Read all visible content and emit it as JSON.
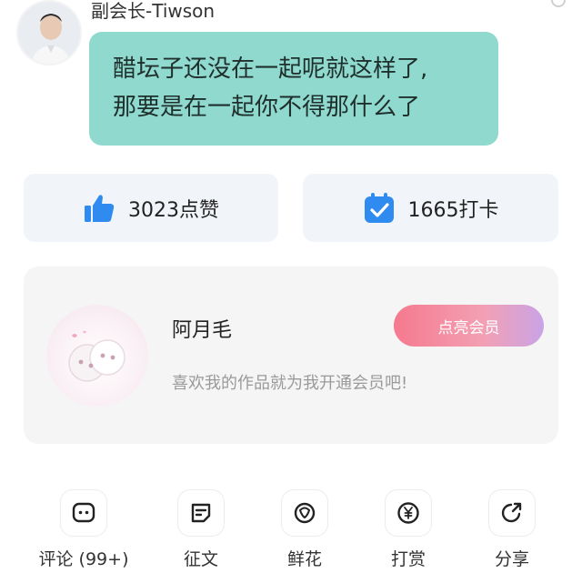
{
  "post": {
    "author": "副会长-Tiwson",
    "message_lines": [
      "醋坛子还没在一起呢就这样了,",
      "那要是在一起你不得那什么了"
    ]
  },
  "stats": {
    "likes": "3023点赞",
    "checkins": "1665打卡"
  },
  "member": {
    "name": "阿月毛",
    "tip": "喜欢我的作品就为我开通会员吧!",
    "button": "点亮会员"
  },
  "actions": [
    {
      "label": "评论 (99+)",
      "icon": "comment-icon"
    },
    {
      "label": "征文",
      "icon": "article-icon"
    },
    {
      "label": "鲜花",
      "icon": "flower-icon"
    },
    {
      "label": "打赏",
      "icon": "yuan-coin-icon"
    },
    {
      "label": "分享",
      "icon": "share-icon"
    }
  ],
  "colors": {
    "bubble": "#8fd9cf",
    "accent_blue": "#2f8bf0",
    "button_gradient_start": "#f5798e",
    "button_gradient_end": "#c9a3e6"
  }
}
